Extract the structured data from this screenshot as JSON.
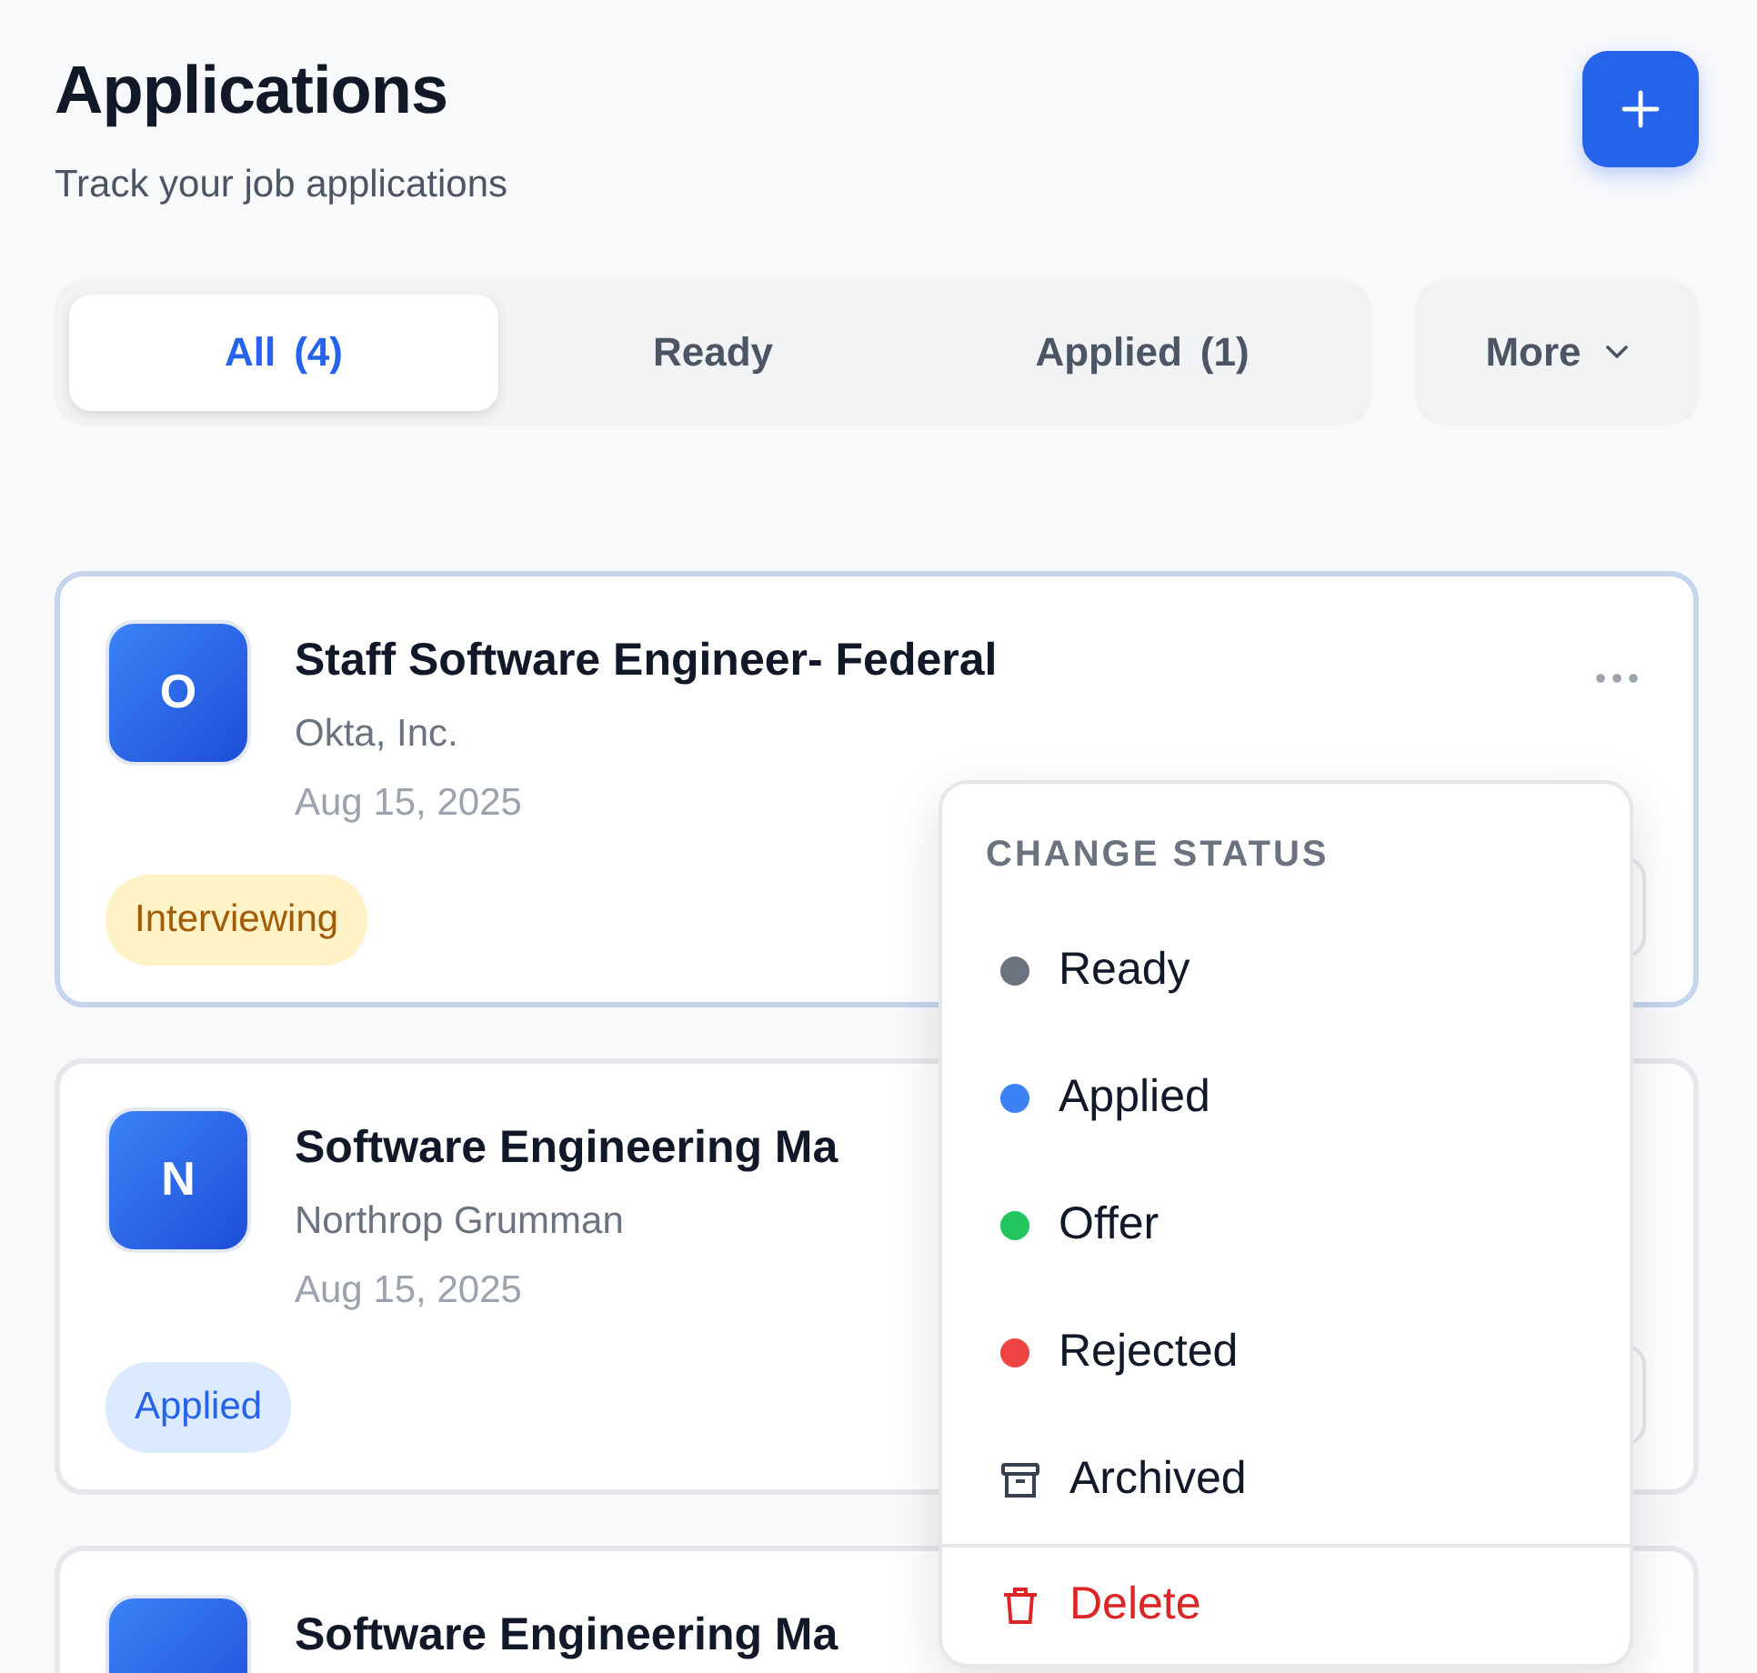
{
  "header": {
    "title": "Applications",
    "subtitle": "Track your job applications"
  },
  "tabs": [
    {
      "label": "All",
      "count": "(4)",
      "selected": true
    },
    {
      "label": "Ready",
      "selected": false
    },
    {
      "label": "Applied",
      "count": "(1)",
      "selected": false
    }
  ],
  "more_button": {
    "label": "More"
  },
  "cards": [
    {
      "initial": "O",
      "title": "Staff Software Engineer- Federal",
      "company": "Okta, Inc.",
      "date": "Aug 15, 2025",
      "status": {
        "label": "Interviewing",
        "kind": "interviewing"
      },
      "selected": true
    },
    {
      "initial": "N",
      "title": "Software Engineering Ma",
      "company": "Northrop Grumman",
      "date": "Aug 15, 2025",
      "status": {
        "label": "Applied",
        "kind": "applied"
      },
      "selected": false
    },
    {
      "title": "Software Engineering Ma",
      "selected": false
    }
  ],
  "status_menu": {
    "heading": "CHANGE STATUS",
    "items": [
      {
        "kind": "status",
        "label": "Ready",
        "color": "#6b7280"
      },
      {
        "kind": "status",
        "label": "Applied",
        "color": "#3b82f6"
      },
      {
        "kind": "status",
        "label": "Offer",
        "color": "#22c55e"
      },
      {
        "kind": "status",
        "label": "Rejected",
        "color": "#ef4444"
      },
      {
        "kind": "archive",
        "label": "Archived"
      },
      {
        "kind": "delete",
        "label": "Delete"
      }
    ]
  }
}
